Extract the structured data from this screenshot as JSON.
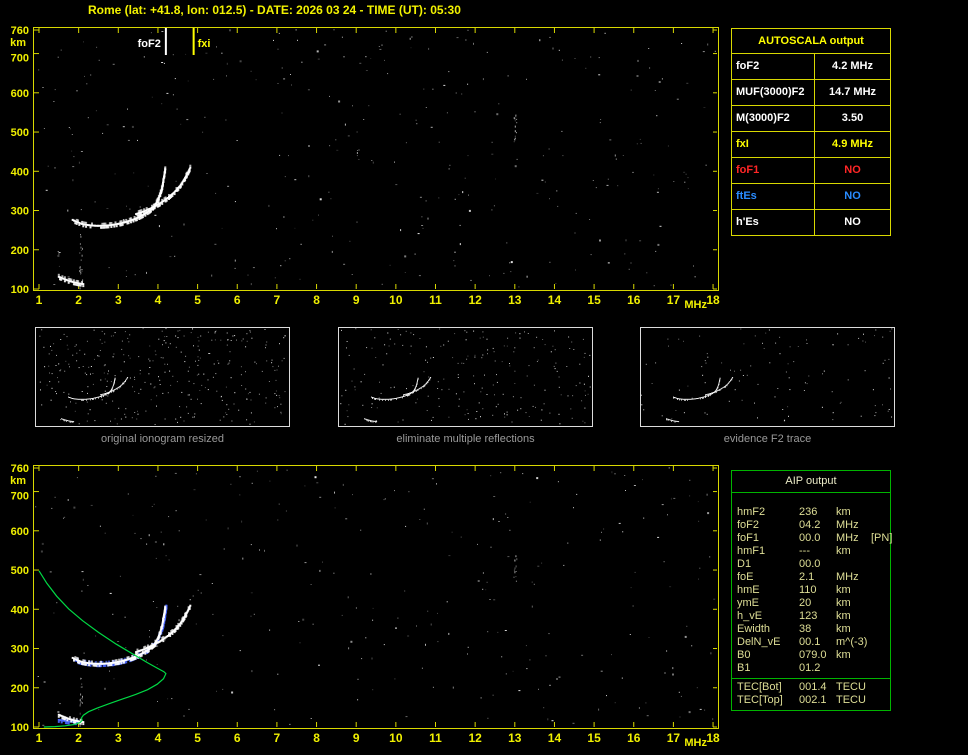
{
  "header": {
    "title": "Rome (lat: +41.8, lon: 012.5) - DATE: 2026 03 24 - TIME (UT): 05:30"
  },
  "colors": {
    "background": "#000000",
    "frame": "#d8d800",
    "axis": "#f0f000",
    "white": "#ffffff",
    "yellow": "#ffff00",
    "red": "#ff2626",
    "blue": "#2a8cff",
    "green_border": "#00b400",
    "profile_green": "#00d844",
    "trace_blue": "#4a66ff",
    "caption_gray": "#9a9a9a"
  },
  "autoscala_table": {
    "title": "AUTOSCALA output",
    "rows": [
      {
        "label": "foF2",
        "value": "4.2 MHz",
        "color": "white"
      },
      {
        "label": "MUF(3000)F2",
        "value": "14.7 MHz",
        "color": "white"
      },
      {
        "label": "M(3000)F2",
        "value": "3.50",
        "color": "white"
      },
      {
        "label": "fxI",
        "value": "4.9 MHz",
        "color": "yellow"
      },
      {
        "label": "foF1",
        "value": "NO",
        "color": "red"
      },
      {
        "label": "ftEs",
        "value": "NO",
        "color": "blue"
      },
      {
        "label": "h'Es",
        "value": "NO",
        "color": "white"
      }
    ]
  },
  "aip_table": {
    "title": "AIP output",
    "rows": [
      {
        "name": "hmF2",
        "value": "236",
        "unit": "km",
        "note": ""
      },
      {
        "name": "foF2",
        "value": "04.2",
        "unit": "MHz",
        "note": ""
      },
      {
        "name": "foF1",
        "value": "00.0",
        "unit": "MHz",
        "note": "[PN]"
      },
      {
        "name": "hmF1",
        "value": "---",
        "unit": "km",
        "note": ""
      },
      {
        "name": "D1",
        "value": "00.0",
        "unit": "",
        "note": ""
      },
      {
        "name": "foE",
        "value": "2.1",
        "unit": "MHz",
        "note": ""
      },
      {
        "name": "hmE",
        "value": "110",
        "unit": "km",
        "note": ""
      },
      {
        "name": "ymE",
        "value": "20",
        "unit": "km",
        "note": ""
      },
      {
        "name": "h_vE",
        "value": "123",
        "unit": "km",
        "note": ""
      },
      {
        "name": "Ewidth",
        "value": "38",
        "unit": "km",
        "note": ""
      },
      {
        "name": "DelN_vE",
        "value": "00.1",
        "unit": "m^(-3)",
        "note": ""
      },
      {
        "name": "B0",
        "value": "079.0",
        "unit": "km",
        "note": ""
      },
      {
        "name": "B1",
        "value": "01.2",
        "unit": "",
        "note": ""
      }
    ],
    "tec_rows": [
      {
        "name": "TEC[Bot]",
        "value": "001.4",
        "unit": "TECU"
      },
      {
        "name": "TEC[Top]",
        "value": "002.1",
        "unit": "TECU"
      }
    ]
  },
  "thumbnails": {
    "items": [
      {
        "caption": "original ionogram resized",
        "seed": 101,
        "noise_specks": 330
      },
      {
        "caption": "eliminate multiple reflections",
        "seed": 202,
        "noise_specks": 215
      },
      {
        "caption": "evidence F2 trace",
        "seed": 303,
        "noise_specks": 110
      }
    ]
  },
  "chart_data": [
    {
      "id": "ionogram_top",
      "type": "scatter",
      "title": "recorded ionogram with autoscaled critical frequencies",
      "xlabel": "MHz",
      "ylabel": "km",
      "xlim": [
        1,
        18
      ],
      "ylim": [
        100,
        760
      ],
      "x_ticks": [
        1,
        2,
        3,
        4,
        5,
        6,
        7,
        8,
        9,
        10,
        11,
        12,
        13,
        14,
        15,
        16,
        17,
        18
      ],
      "y_ticks": [
        760,
        700,
        600,
        500,
        400,
        300,
        200,
        100
      ],
      "grid": false,
      "markers": [
        {
          "label": "foF2",
          "x": 4.2,
          "color": "white",
          "align": "left"
        },
        {
          "label": "fxi",
          "x": 4.9,
          "color": "yellow",
          "align": "right"
        }
      ],
      "series": [
        {
          "name": "F2-trace-ordinary",
          "color": "#ffffff",
          "style": "dots",
          "points": [
            [
              1.85,
              276
            ],
            [
              1.95,
              271
            ],
            [
              2.05,
              267
            ],
            [
              2.15,
              264
            ],
            [
              2.3,
              262
            ],
            [
              2.45,
              261
            ],
            [
              2.6,
              261
            ],
            [
              2.75,
              262
            ],
            [
              2.9,
              264
            ],
            [
              3.05,
              267
            ],
            [
              3.2,
              271
            ],
            [
              3.35,
              276
            ],
            [
              3.5,
              282
            ],
            [
              3.65,
              290
            ],
            [
              3.8,
              300
            ],
            [
              3.92,
              312
            ],
            [
              4.0,
              326
            ],
            [
              4.06,
              342
            ],
            [
              4.11,
              360
            ],
            [
              4.14,
              378
            ],
            [
              4.17,
              396
            ],
            [
              4.19,
              408
            ]
          ]
        },
        {
          "name": "F2-trace-extraordinary",
          "color": "#ffffff",
          "style": "dots",
          "points": [
            [
              3.45,
              291
            ],
            [
              3.65,
              298
            ],
            [
              3.85,
              307
            ],
            [
              4.05,
              318
            ],
            [
              4.25,
              332
            ],
            [
              4.42,
              347
            ],
            [
              4.56,
              363
            ],
            [
              4.67,
              380
            ],
            [
              4.76,
              397
            ],
            [
              4.83,
              412
            ]
          ]
        },
        {
          "name": "E-region-echoes",
          "color": "#ffffff",
          "style": "dots",
          "points": [
            [
              1.5,
              131
            ],
            [
              1.62,
              126
            ],
            [
              1.75,
              121
            ],
            [
              1.88,
              117
            ],
            [
              2.02,
              114
            ],
            [
              2.15,
              112
            ]
          ]
        }
      ],
      "noise": {
        "seed": 13,
        "specks": 340,
        "columns": [
          {
            "x": 2.05,
            "y_range": [
              100,
              250
            ],
            "count": 22
          },
          {
            "x": 13.0,
            "y_range": [
              470,
              545
            ],
            "count": 16
          },
          {
            "x": 9.05,
            "y_range": [
              430,
              470
            ],
            "count": 5
          }
        ]
      }
    },
    {
      "id": "ionogram_bottom",
      "type": "scatter",
      "title": "ionogram with restored trace and electron density profile",
      "xlabel": "MHz",
      "ylabel": "km",
      "xlim": [
        1,
        18
      ],
      "ylim": [
        100,
        760
      ],
      "x_ticks": [
        1,
        2,
        3,
        4,
        5,
        6,
        7,
        8,
        9,
        10,
        11,
        12,
        13,
        14,
        15,
        16,
        17,
        18
      ],
      "y_ticks": [
        760,
        700,
        600,
        500,
        400,
        300,
        200,
        100
      ],
      "grid": false,
      "series": [
        {
          "name": "restored-trace",
          "color": "#4a66ff",
          "style": "dots",
          "points": [
            [
              1.9,
              270
            ],
            [
              2.1,
              265
            ],
            [
              2.3,
              261
            ],
            [
              2.5,
              260
            ],
            [
              2.7,
              261
            ],
            [
              2.9,
              263
            ],
            [
              3.1,
              267
            ],
            [
              3.3,
              273
            ],
            [
              3.5,
              281
            ],
            [
              3.7,
              292
            ],
            [
              3.85,
              304
            ],
            [
              3.97,
              319
            ],
            [
              4.06,
              337
            ],
            [
              4.13,
              357
            ],
            [
              4.17,
              377
            ],
            [
              4.2,
              397
            ],
            [
              4.22,
              412
            ]
          ]
        },
        {
          "name": "restored-E-trace",
          "color": "#4a66ff",
          "style": "dots",
          "points": [
            [
              1.5,
              118
            ],
            [
              1.75,
              114
            ],
            [
              2.0,
              112
            ]
          ]
        },
        {
          "name": "F2-trace-ordinary",
          "color": "#ffffff",
          "style": "dots",
          "points": [
            [
              1.85,
              276
            ],
            [
              1.95,
              271
            ],
            [
              2.05,
              267
            ],
            [
              2.15,
              264
            ],
            [
              2.3,
              262
            ],
            [
              2.45,
              261
            ],
            [
              2.6,
              261
            ],
            [
              2.75,
              262
            ],
            [
              2.9,
              264
            ],
            [
              3.05,
              267
            ],
            [
              3.2,
              271
            ],
            [
              3.35,
              276
            ],
            [
              3.5,
              282
            ],
            [
              3.65,
              290
            ],
            [
              3.8,
              300
            ],
            [
              3.92,
              312
            ],
            [
              4.0,
              326
            ],
            [
              4.06,
              342
            ],
            [
              4.11,
              360
            ],
            [
              4.14,
              378
            ],
            [
              4.17,
              396
            ],
            [
              4.19,
              408
            ]
          ]
        },
        {
          "name": "F2-trace-extraordinary",
          "color": "#ffffff",
          "style": "dots",
          "points": [
            [
              3.45,
              291
            ],
            [
              3.65,
              298
            ],
            [
              3.85,
              307
            ],
            [
              4.05,
              318
            ],
            [
              4.25,
              332
            ],
            [
              4.42,
              347
            ],
            [
              4.56,
              363
            ],
            [
              4.67,
              380
            ],
            [
              4.76,
              397
            ],
            [
              4.83,
              412
            ]
          ]
        },
        {
          "name": "E-region-echoes",
          "color": "#ffffff",
          "style": "dots",
          "points": [
            [
              1.5,
              131
            ],
            [
              1.62,
              126
            ],
            [
              1.75,
              121
            ],
            [
              1.88,
              117
            ],
            [
              2.02,
              114
            ],
            [
              2.15,
              112
            ]
          ]
        },
        {
          "name": "electron-density-profile",
          "color": "#00d844",
          "style": "line",
          "points": [
            [
              1.0,
              498
            ],
            [
              1.2,
              466
            ],
            [
              1.45,
              433
            ],
            [
              1.75,
              401
            ],
            [
              2.1,
              371
            ],
            [
              2.5,
              341
            ],
            [
              2.95,
              311
            ],
            [
              3.4,
              284
            ],
            [
              3.75,
              263
            ],
            [
              4.0,
              249
            ],
            [
              4.15,
              241
            ],
            [
              4.2,
              236
            ],
            [
              4.14,
              223
            ],
            [
              3.98,
              209
            ],
            [
              3.74,
              195
            ],
            [
              3.44,
              183
            ],
            [
              3.1,
              171
            ],
            [
              2.76,
              159
            ],
            [
              2.46,
              148
            ],
            [
              2.25,
              139
            ],
            [
              2.12,
              130
            ],
            [
              2.07,
              123
            ],
            [
              2.09,
              117
            ],
            [
              2.03,
              111
            ],
            [
              1.88,
              106
            ],
            [
              1.66,
              103
            ],
            [
              1.4,
              101
            ],
            [
              1.12,
              100
            ]
          ]
        }
      ],
      "noise": {
        "seed": 47,
        "specks": 300,
        "columns": [
          {
            "x": 2.05,
            "y_range": [
              100,
              240
            ],
            "count": 18
          },
          {
            "x": 13.0,
            "y_range": [
              470,
              540
            ],
            "count": 12
          }
        ]
      }
    }
  ]
}
